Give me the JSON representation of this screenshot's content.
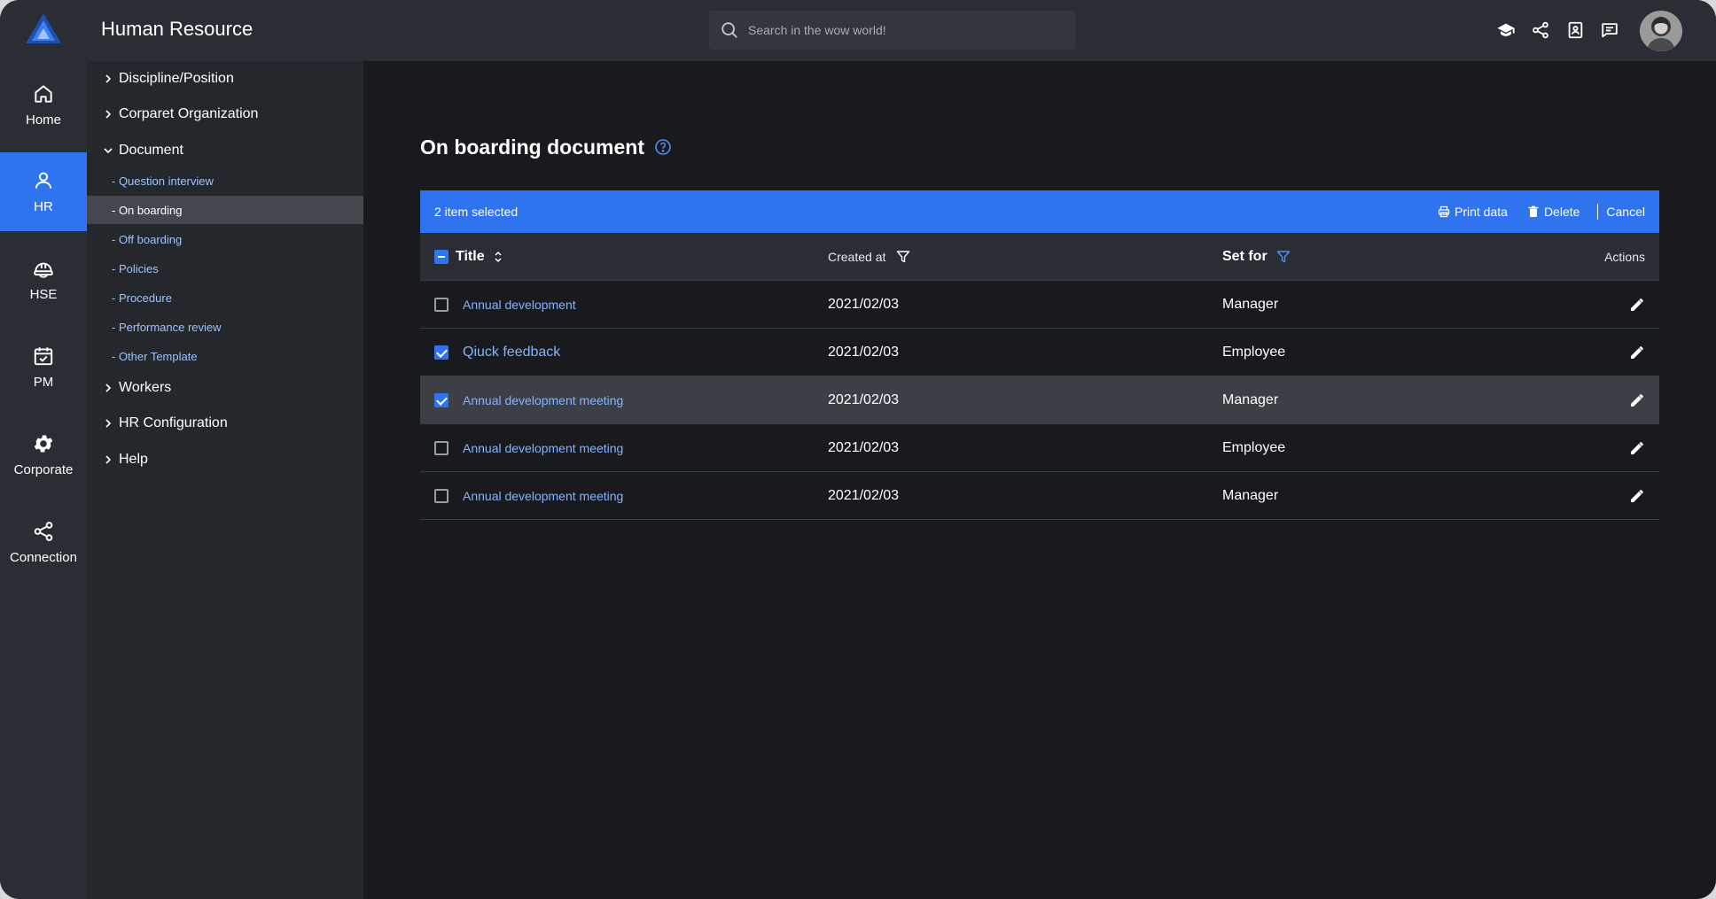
{
  "header": {
    "title": "Human Resource",
    "search_placeholder": "Search in the wow world!",
    "icons": [
      "graduation-cap-icon",
      "share-icon",
      "contact-book-icon",
      "message-icon"
    ]
  },
  "rail": {
    "items": [
      {
        "label": "Home",
        "icon": "home-icon"
      },
      {
        "label": "HR",
        "icon": "person-icon",
        "active": true
      },
      {
        "label": "HSE",
        "icon": "hard-hat-icon"
      },
      {
        "label": "PM",
        "icon": "calendar-check-icon"
      },
      {
        "label": "Corporate",
        "icon": "gear-icon"
      },
      {
        "label": "Connection",
        "icon": "share-icon"
      }
    ]
  },
  "tree": {
    "nodes": [
      {
        "label": "Discipline/Position"
      },
      {
        "label": "Corparet Organization"
      },
      {
        "label": "Document",
        "expanded": true
      },
      {
        "label": "Workers"
      },
      {
        "label": "HR Configuration"
      },
      {
        "label": "Help"
      }
    ],
    "document_children": [
      "- Question interview",
      "- On boarding",
      "- Off boarding",
      "- Policies",
      "- Procedure",
      "- Performance review",
      "- Other Template"
    ],
    "active_child": "- On boarding"
  },
  "main": {
    "title": "On boarding document",
    "selection": {
      "text": "2 item selected",
      "print_label": "Print data",
      "delete_label": "Delete",
      "cancel_label": "Cancel"
    },
    "columns": {
      "title": "Title",
      "created_at": "Created at",
      "set_for": "Set for",
      "actions": "Actions"
    },
    "rows": [
      {
        "title": "Annual development",
        "created_at": "2021/02/03",
        "set_for": "Manager",
        "checked": false
      },
      {
        "title": "Qiuck feedback",
        "created_at": "2021/02/03",
        "set_for": "Employee",
        "checked": true
      },
      {
        "title": "Annual development meeting",
        "created_at": "2021/02/03",
        "set_for": "Manager",
        "checked": true
      },
      {
        "title": "Annual development meeting",
        "created_at": "2021/02/03",
        "set_for": "Employee",
        "checked": false
      },
      {
        "title": "Annual development meeting",
        "created_at": "2021/02/03",
        "set_for": "Manager",
        "checked": false
      }
    ]
  },
  "colors": {
    "accent": "#2f74ee",
    "link": "#86b3ff",
    "background": "#191a1e",
    "panel": "#24272c",
    "rail": "#2a2d33"
  }
}
